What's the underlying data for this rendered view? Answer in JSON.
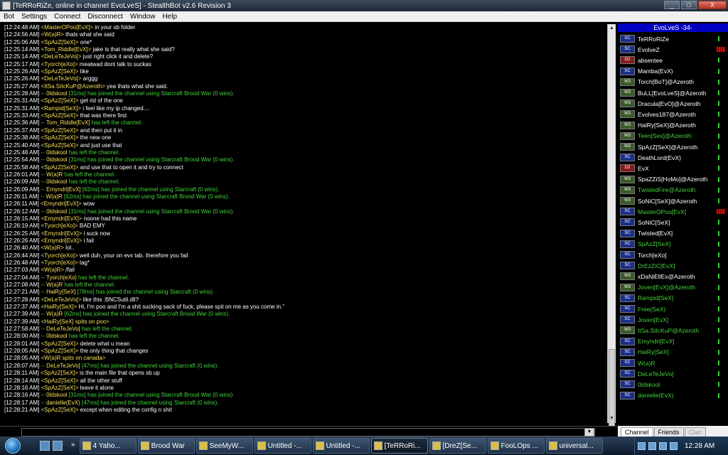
{
  "window": {
    "title": "[TeRRoRiZe, online in channel EvoLveS] - StealthBot v2.6 Revision 3",
    "min": "_",
    "max": "□",
    "close": "X"
  },
  "menu": [
    "Bot",
    "Settings",
    "Connect",
    "Disconnect",
    "Window",
    "Help"
  ],
  "chat": [
    {
      "ts": "[12:24:48 AM]",
      "type": "msg",
      "name": "MasterOPoo[EvX]",
      "text": "in your sb folder"
    },
    {
      "ts": "[12:24:56 AM]",
      "type": "msg",
      "name": "W(a)R",
      "text": "thats what she said"
    },
    {
      "ts": "[12:25:06 AM]",
      "type": "msg",
      "name": "SpAzZ[SeX]",
      "text": "one*"
    },
    {
      "ts": "[12:25:14 AM]",
      "type": "msg",
      "name": "Tom_Riddle[EvX]",
      "text": "jake is that really what she said?"
    },
    {
      "ts": "[12:25:14 AM]",
      "type": "msg",
      "name": "DeLeTeJeVo[",
      "text": "just right click it and delete?"
    },
    {
      "ts": "[12:25:17 AM]",
      "type": "msg",
      "name": "Tyorch[eXo]",
      "text": "meatwad dont talk to suckas"
    },
    {
      "ts": "[12:25:26 AM]",
      "type": "msg",
      "name": "SpAzZ[SeX]",
      "text": "like"
    },
    {
      "ts": "[12:25:26 AM]",
      "type": "msg",
      "name": "DeLeTeJeVo[",
      "text": "arggg"
    },
    {
      "ts": "[12:25:27 AM]",
      "type": "msg",
      "name": "ItSa.StIcKuP@Azeroth",
      "text": "yea thats what she said."
    },
    {
      "ts": "[12:25:28 AM]",
      "type": "join",
      "name": "0ldskool",
      "text": "[31ms] has joined the channel using Starcraft Brood War (0 wins)."
    },
    {
      "ts": "[12:25:31 AM]",
      "type": "msg",
      "name": "SpAzZ[SeX]",
      "text": "get rid of the one"
    },
    {
      "ts": "[12:25:31 AM]",
      "type": "msg",
      "name": "Rampid[SeX]",
      "text": "i feel like my ip changed...."
    },
    {
      "ts": "[12:25:33 AM]",
      "type": "msg",
      "name": "SpAzZ[SeX]",
      "text": "that was there first"
    },
    {
      "ts": "[12:25:36 AM]",
      "type": "left",
      "name": "Tom_Riddle[EvX]",
      "text": "has left the channel."
    },
    {
      "ts": "[12:25:37 AM]",
      "type": "msg",
      "name": "SpAzZ[SeX]",
      "text": "and then put it in"
    },
    {
      "ts": "[12:25:38 AM]",
      "type": "msg",
      "name": "SpAzZ[SeX]",
      "text": "the new one"
    },
    {
      "ts": "[12:25:40 AM]",
      "type": "msg",
      "name": "SpAzZ[SeX]",
      "text": "and just use that"
    },
    {
      "ts": "[12:25:48 AM]",
      "type": "left",
      "name": "0ldskool",
      "text": "has left the channel."
    },
    {
      "ts": "[12:25:54 AM]",
      "type": "join",
      "name": "0ldskool",
      "text": "[31ms] has joined the channel using Starcraft Brood War (0 wins)."
    },
    {
      "ts": "[12:25:58 AM]",
      "type": "msg",
      "name": "SpAzZ[SeX]",
      "text": "and use that to open it and try to connect"
    },
    {
      "ts": "[12:26:01 AM]",
      "type": "left",
      "name": "W(a)R",
      "text": "has left the channel."
    },
    {
      "ts": "[12:26:09 AM]",
      "type": "left",
      "name": "0ldskool",
      "text": "has left the channel."
    },
    {
      "ts": "[12:26:09 AM]",
      "type": "join",
      "name": "Emyndri[EvX]",
      "text": "[62ms] has joined the channel using Starcraft (0 wins)."
    },
    {
      "ts": "[12:26:11 AM]",
      "type": "join",
      "name": "W(a)R",
      "text": "[62ms] has joined the channel using Starcraft Brood War (0 wins)."
    },
    {
      "ts": "[12:26:11 AM]",
      "type": "msg",
      "name": "Emyndri[EvX]",
      "text": "wow"
    },
    {
      "ts": "[12:26:12 AM]",
      "type": "join",
      "name": "0ldskool",
      "text": "[31ms] has joined the channel using Starcraft Brood War (0 wins)."
    },
    {
      "ts": "[12:26:15 AM]",
      "type": "msg",
      "name": "Emyndri[EvX]",
      "text": "noone had this name"
    },
    {
      "ts": "[12:26:19 AM]",
      "type": "msg",
      "name": "Tyorch[eXo]",
      "text": "BAD EMY"
    },
    {
      "ts": "[12:26:25 AM]",
      "type": "msg",
      "name": "Emyndri[EvX]",
      "text": "i suck now"
    },
    {
      "ts": "[12:26:26 AM]",
      "type": "msg",
      "name": "Emyndri[EvX]",
      "text": "i fail"
    },
    {
      "ts": "[12:26:40 AM]",
      "type": "msg",
      "name": "W(a)R",
      "text": "lol.."
    },
    {
      "ts": "[12:26:44 AM]",
      "type": "msg",
      "name": "Tyorch[eXo]",
      "text": "well duh, your on evx tab. therefore you fail"
    },
    {
      "ts": "[12:26:48 AM]",
      "type": "msg",
      "name": "Tyorch[eXo]",
      "text": "tag*"
    },
    {
      "ts": "[12:27:03 AM]",
      "type": "msg",
      "name": "W(a)R",
      "text": "/fail"
    },
    {
      "ts": "[12:27:04 AM]",
      "type": "left",
      "name": "Tyorch[eXo]",
      "text": "has left the channel."
    },
    {
      "ts": "[12:27:08 AM]",
      "type": "left",
      "name": "W(a)R",
      "text": "has left the channel."
    },
    {
      "ts": "[12:27:21 AM]",
      "type": "join",
      "name": "HaiRy[SeX]",
      "text": "[78ms] has joined the channel using Starcraft (0 wins)."
    },
    {
      "ts": "[12:27:28 AM]",
      "type": "msg",
      "name": "DeLeTeJeVo[",
      "text": "like this :BNCSutil.dll?"
    },
    {
      "ts": "[12:27:37 AM]",
      "type": "msg",
      "name": "HaiRy[SeX]",
      "text": "Hi, I'm poo and I'm a shit sucking sack of fuck, please spit on me as you come in.\""
    },
    {
      "ts": "[12:27:39 AM]",
      "type": "join",
      "name": "W(a)R",
      "text": "[62ms] has joined the channel using Starcraft Brood War (0 wins)."
    },
    {
      "ts": "[12:27:39 AM]",
      "type": "emote",
      "name": "HaiRy[SeX]",
      "text": "spits on poo>"
    },
    {
      "ts": "[12:27:58 AM]",
      "type": "left",
      "name": "DeLeTeJeVo[",
      "text": "has left the channel."
    },
    {
      "ts": "[12:28:00 AM]",
      "type": "left",
      "name": "0ldskool",
      "text": "has left the channel."
    },
    {
      "ts": "[12:28:01 AM]",
      "type": "msg",
      "name": "SpAzZ[SeX]",
      "text": "delete what u mean"
    },
    {
      "ts": "[12:28:05 AM]",
      "type": "msg",
      "name": "SpAzZ[SeX]",
      "text": "the only thing that changes"
    },
    {
      "ts": "[12:28:05 AM]",
      "type": "emote",
      "name": "W(a)R",
      "text": "spits on canada>"
    },
    {
      "ts": "[12:28:07 AM]",
      "type": "join",
      "name": "DeLeTeJeVo[",
      "text": "[47ms] has joined the channel using Starcraft (0 wins)."
    },
    {
      "ts": "[12:28:11 AM]",
      "type": "msg",
      "name": "SpAzZ[SeX]",
      "text": "is the main file that opens sb up"
    },
    {
      "ts": "[12:28:14 AM]",
      "type": "msg",
      "name": "SpAzZ[SeX]",
      "text": "all the other stuff"
    },
    {
      "ts": "[12:28:16 AM]",
      "type": "msg",
      "name": "SpAzZ[SeX]",
      "text": "leave it alone"
    },
    {
      "ts": "[12:28:16 AM]",
      "type": "join",
      "name": "0ldskool",
      "text": "[31ms] has joined the channel using Starcraft Brood War (0 wins)."
    },
    {
      "ts": "[12:28:17 AM]",
      "type": "join",
      "name": "danielle(EvX)",
      "text": "[47ms] has joined the channel using Starcraft (0 wins)."
    },
    {
      "ts": "[12:28:21 AM]",
      "type": "msg",
      "name": "SpAzZ[SeX]",
      "text": "except when editing the config n shit"
    }
  ],
  "channel": {
    "header": "EvoLveS -34-",
    "users": [
      {
        "name": "TeRRoRiZe",
        "icon": "SC",
        "color": "white",
        "lag": "green"
      },
      {
        "name": "EvolveZ",
        "icon": "SC",
        "color": "white",
        "lag": "red"
      },
      {
        "name": "absentee",
        "icon": "D2",
        "color": "white",
        "lag": "green"
      },
      {
        "name": "Mamba(EvX)",
        "icon": "SC",
        "color": "white",
        "lag": "green"
      },
      {
        "name": "Torch[BoT]@Azeroth",
        "icon": "W3",
        "color": "white",
        "lag": "green"
      },
      {
        "name": "BuLL[EvoLveS]@Azeroth",
        "icon": "W3",
        "color": "white",
        "lag": "green"
      },
      {
        "name": "Dracula[EvO]@Azeroth",
        "icon": "W3",
        "color": "white",
        "lag": "green"
      },
      {
        "name": "Evolves187@Azeroth",
        "icon": "W3",
        "color": "white",
        "lag": "green"
      },
      {
        "name": "HaiRy[SeX]@Azeroth",
        "icon": "W3",
        "color": "white",
        "lag": "green"
      },
      {
        "name": "Teen[Sex]@Azeroth",
        "icon": "W3",
        "color": "green",
        "lag": "green"
      },
      {
        "name": "SpAzZ[SeX]@Azeroth",
        "icon": "W3",
        "color": "white",
        "lag": "green"
      },
      {
        "name": "DeathLord(EvX)",
        "icon": "SC",
        "color": "white",
        "lag": "green"
      },
      {
        "name": "EvX",
        "icon": "D2",
        "color": "white",
        "lag": "green"
      },
      {
        "name": "SpaZZiS[HoMo]@Azeroth",
        "icon": "W3",
        "color": "white",
        "lag": "green"
      },
      {
        "name": "TwistedFire@Azeroth",
        "icon": "W3",
        "color": "green",
        "lag": "green"
      },
      {
        "name": "SoNiC[SeX]@Azeroth",
        "icon": "W3",
        "color": "white",
        "lag": "green"
      },
      {
        "name": "MasterOPoo[EvX]",
        "icon": "SC",
        "color": "green",
        "lag": "red"
      },
      {
        "name": "SoNiC[SeX]",
        "icon": "SC",
        "color": "white",
        "lag": "green"
      },
      {
        "name": "Twisted[EvX]",
        "icon": "SC",
        "color": "white",
        "lag": "green"
      },
      {
        "name": "SpAzZ[SeX]",
        "icon": "SC",
        "color": "green",
        "lag": "green"
      },
      {
        "name": "Torch[eXo]",
        "icon": "SC",
        "color": "white",
        "lag": "green"
      },
      {
        "name": "DrEzZiC[EvX]",
        "icon": "SC",
        "color": "green",
        "lag": "green"
      },
      {
        "name": "xDaNiEllEx@Azeroth",
        "icon": "W3",
        "color": "white",
        "lag": "green"
      },
      {
        "name": "Joven[EvX]@Azeroth",
        "icon": "W3",
        "color": "green",
        "lag": "green"
      },
      {
        "name": "Rampid[SeX]",
        "icon": "SC",
        "color": "green",
        "lag": "green"
      },
      {
        "name": "Free(SeX)",
        "icon": "SC",
        "color": "green",
        "lag": "green"
      },
      {
        "name": "Joven[EvX]",
        "icon": "SC",
        "color": "green",
        "lag": "green"
      },
      {
        "name": "ItSa.StIcKuP@Azeroth",
        "icon": "W3",
        "color": "green",
        "lag": "green"
      },
      {
        "name": "Emyndri[EvX]",
        "icon": "SC",
        "color": "green",
        "lag": "green"
      },
      {
        "name": "HaiRy[SeX]",
        "icon": "SC",
        "color": "green",
        "lag": "green"
      },
      {
        "name": "W(a)R",
        "icon": "SC",
        "color": "green",
        "lag": "green"
      },
      {
        "name": "DeLeTeJeVo[",
        "icon": "SC",
        "color": "green",
        "lag": "green"
      },
      {
        "name": "0ldskool",
        "icon": "SC",
        "color": "green",
        "lag": "green"
      },
      {
        "name": "danielle(EvX)",
        "icon": "SC",
        "color": "green",
        "lag": "green"
      }
    ]
  },
  "input": {
    "value": "",
    "dropdown": "▼"
  },
  "tabs": [
    {
      "label": "Channel",
      "state": "active"
    },
    {
      "label": "Friends",
      "state": "normal"
    },
    {
      "label": "Clan",
      "state": "disabled"
    }
  ],
  "taskbar": {
    "ql_more": "»",
    "tasks": [
      {
        "label": "4 Yaho...",
        "active": false
      },
      {
        "label": "Brood War",
        "active": false
      },
      {
        "label": "SeeMyW...",
        "active": false
      },
      {
        "label": "Untitled -...",
        "active": false
      },
      {
        "label": "Untitled -...",
        "active": false
      },
      {
        "label": "[TeRRoRi...",
        "active": true
      },
      {
        "label": "[DreZ[Se...",
        "active": false
      },
      {
        "label": "FooLOps ...",
        "active": false
      },
      {
        "label": "universal...",
        "active": false
      }
    ],
    "clock": "12:28 AM"
  },
  "colors": {
    "chat_bg": "#000000",
    "name": "#f5e05a",
    "event": "#43d43a",
    "channel_header": "#0000c0"
  }
}
